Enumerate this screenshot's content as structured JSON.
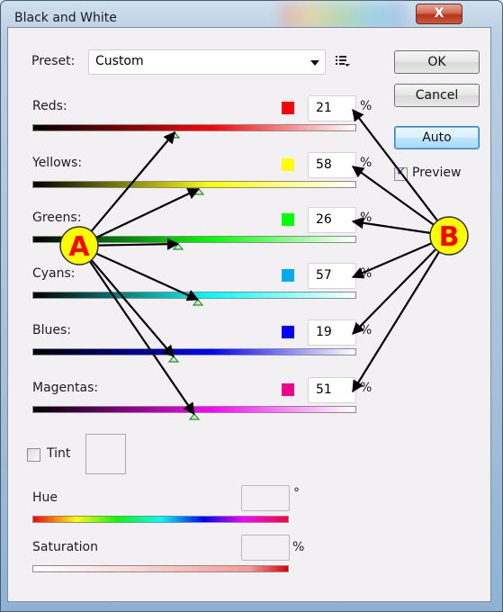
{
  "window": {
    "title": "Black and White",
    "close_glyph": "X"
  },
  "preset": {
    "label": "Preset:",
    "value": "Custom",
    "menu_icon": "preset-options-icon"
  },
  "buttons": {
    "ok": "OK",
    "cancel": "Cancel",
    "auto": "Auto"
  },
  "preview": {
    "label": "Preview",
    "checked": true
  },
  "sliders": [
    {
      "label": "Reds:",
      "value": "21",
      "percent": 21,
      "unit": "%",
      "color": "#ff0000",
      "gradient": [
        "#000000",
        "#ff0000",
        "#ffffff"
      ]
    },
    {
      "label": "Yellows:",
      "value": "58",
      "percent": 58,
      "unit": "%",
      "color": "#ffff00",
      "gradient": [
        "#000000",
        "#ffff00",
        "#ffffff"
      ]
    },
    {
      "label": "Greens:",
      "value": "26",
      "percent": 26,
      "unit": "%",
      "color": "#00ff00",
      "gradient": [
        "#000000",
        "#00ff00",
        "#ffffff"
      ]
    },
    {
      "label": "Cyans:",
      "value": "57",
      "percent": 57,
      "unit": "%",
      "color": "#00aaee",
      "gradient": [
        "#000000",
        "#00ffff",
        "#ffffff"
      ]
    },
    {
      "label": "Blues:",
      "value": "19",
      "percent": 19,
      "unit": "%",
      "color": "#0000ff",
      "gradient": [
        "#000000",
        "#0000ff",
        "#ffffff"
      ]
    },
    {
      "label": "Magentas:",
      "value": "51",
      "percent": 51,
      "unit": "%",
      "color": "#ee0088",
      "gradient": [
        "#000000",
        "#ff00ff",
        "#ffffff"
      ]
    }
  ],
  "tint": {
    "label": "Tint",
    "checked": false
  },
  "hue": {
    "label": "Hue",
    "value": "",
    "unit": "°"
  },
  "saturation": {
    "label": "Saturation",
    "value": "",
    "unit": "%"
  },
  "annotations": {
    "a": {
      "letter": "A",
      "description": "points to slider thumbs"
    },
    "b": {
      "letter": "B",
      "description": "points to percentage value fields"
    },
    "circle_fill": "#ffff00",
    "letter_color": "#ff0000"
  }
}
